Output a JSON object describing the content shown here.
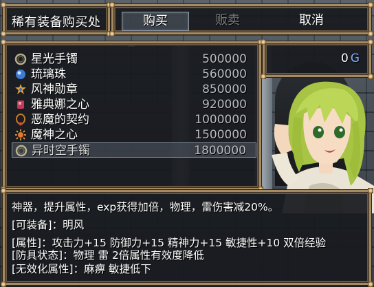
{
  "window_title": "稀有装备购买处",
  "commands": [
    {
      "label": "购买",
      "state": "selected"
    },
    {
      "label": "贩卖",
      "state": "disabled"
    },
    {
      "label": "取消",
      "state": "normal"
    }
  ],
  "items": [
    {
      "name": "星光手镯",
      "price": "500000",
      "icon": "bracelet-icon"
    },
    {
      "name": "琉璃珠",
      "price": "560000",
      "icon": "orb-icon"
    },
    {
      "name": "风神勋章",
      "price": "850000",
      "icon": "medal-icon"
    },
    {
      "name": "雅典娜之心",
      "price": "920000",
      "icon": "heart-gem-icon"
    },
    {
      "name": "恶魔的契约",
      "price": "1000000",
      "icon": "necklace-icon"
    },
    {
      "name": "魔神之心",
      "price": "1500000",
      "icon": "sun-gem-icon"
    },
    {
      "name": "异时空手镯",
      "price": "1800000",
      "icon": "bracelet-icon"
    }
  ],
  "selected_item_index": 6,
  "gold": {
    "amount": "0",
    "unit": "G"
  },
  "help": {
    "line1": "神器，提升属性，exp获得加倍，物理，雷伤害减20%。",
    "line2": "[可装备]：明风",
    "line3": "[属性]：攻击力+15 防御力+15 精神力+15 敏捷性+10 双倍经验",
    "line4": "[防具状态]：物理 雷 2倍属性有效度降低",
    "line5": "[无效化属性]：麻痹 敏捷低下"
  },
  "colors": {
    "frame": "#a58a62",
    "window_bg": "#181a1e",
    "disabled_text": "#7a7d82",
    "gold_unit": "#7fb2ff"
  }
}
